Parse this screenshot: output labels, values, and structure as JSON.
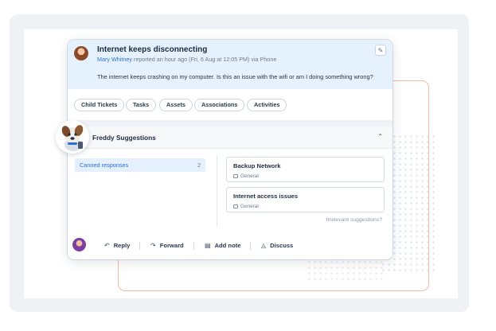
{
  "ticket": {
    "title": "Internet keeps disconnecting",
    "requester": "Mary Whitney",
    "meta_suffix": " reported an hour ago (Fri, 6 Aug at 12:05 PM) via Phone",
    "body": "The internet keeps crashing on my computer. Is this an issue with the wifi or am I doing something wrong?"
  },
  "tabs": [
    "Child Tickets",
    "Tasks",
    "Assets",
    "Associations",
    "Activities"
  ],
  "freddy": {
    "title": "Freddy Suggestions",
    "canned_label": "Canned responses",
    "canned_count": "2",
    "suggestions": [
      {
        "title": "Backup Network",
        "tag": "General"
      },
      {
        "title": "Internet access issues",
        "tag": "General"
      }
    ],
    "irrelevant": "Irrelevant suggestions?"
  },
  "actions": {
    "reply": "Reply",
    "forward": "Forward",
    "add_note": "Add note",
    "discuss": "Discuss"
  },
  "colors": {
    "header_bg": "#e5f2fd",
    "accent_blue": "#2c6fd6",
    "orange_outline": "#f3b9a7"
  }
}
